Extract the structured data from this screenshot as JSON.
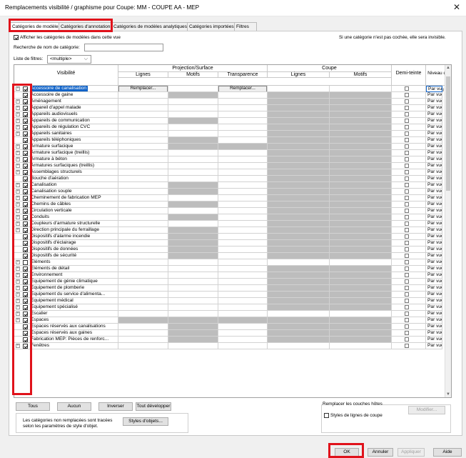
{
  "window": {
    "title": "Remplacements visibilité / graphisme pour Coupe: MM - COUPE AA - MEP",
    "close": "✕"
  },
  "tabs": [
    {
      "label": "Catégories de modèles",
      "active": true
    },
    {
      "label": "Catégories d'annotations"
    },
    {
      "label": "Catégories de modèles analytiques"
    },
    {
      "label": "Catégories importées"
    },
    {
      "label": "Filtres"
    }
  ],
  "show_categories_label": "Afficher les catégories de modèles dans cette vue",
  "hint": "Si une catégorie n'est pas cochée, elle sera invisible.",
  "search": {
    "label": "Recherche de nom de catégorie:",
    "value": ""
  },
  "filter_list": {
    "label": "Liste de filtres:",
    "value": "<multiple>"
  },
  "grid": {
    "headers": {
      "visibility": "Visibilité",
      "projection": "Projection/Surface",
      "section": "Coupe",
      "lines": "Lignes",
      "patterns": "Motifs",
      "transparency": "Transparence",
      "halftone": "Demi-teinte",
      "detail_level": "Niveau de détail"
    },
    "replace_label": "Remplacer...",
    "detail_value": "Par vue",
    "rows": [
      {
        "name": "Accessoire de canalisation",
        "checked": true,
        "sel": true,
        "exp": true,
        "g": [
          0,
          0,
          0,
          0,
          0
        ]
      },
      {
        "name": "Accessoire de gaine",
        "checked": true,
        "exp": false,
        "g": [
          0,
          1,
          0,
          1,
          1
        ]
      },
      {
        "name": "Aménagement",
        "checked": true,
        "exp": true,
        "g": [
          0,
          0,
          0,
          1,
          1
        ]
      },
      {
        "name": "Appareil d'appel malade",
        "checked": true,
        "exp": true,
        "g": [
          0,
          0,
          0,
          1,
          1
        ]
      },
      {
        "name": "Appareils audiovisuels",
        "checked": true,
        "exp": true,
        "g": [
          0,
          0,
          0,
          1,
          1
        ]
      },
      {
        "name": "Appareils de communication",
        "checked": true,
        "exp": true,
        "g": [
          0,
          1,
          0,
          1,
          1
        ]
      },
      {
        "name": "Appareils de régulation CVC",
        "checked": true,
        "exp": true,
        "g": [
          0,
          0,
          0,
          1,
          1
        ]
      },
      {
        "name": "Appareils sanitaires",
        "checked": true,
        "exp": true,
        "g": [
          0,
          0,
          0,
          1,
          1
        ]
      },
      {
        "name": "Appareils téléphoniques",
        "checked": true,
        "exp": false,
        "g": [
          0,
          1,
          0,
          1,
          1
        ]
      },
      {
        "name": "Armature surfacique",
        "checked": true,
        "exp": true,
        "g": [
          0,
          1,
          1,
          1,
          1
        ]
      },
      {
        "name": "Armature surfacique (treillis)",
        "checked": true,
        "exp": true,
        "g": [
          0,
          0,
          0,
          1,
          1
        ]
      },
      {
        "name": "Armature à béton",
        "checked": true,
        "exp": true,
        "g": [
          0,
          0,
          0,
          1,
          1
        ]
      },
      {
        "name": "Armatures surfaciques (treillis)",
        "checked": true,
        "exp": true,
        "g": [
          0,
          0,
          0,
          1,
          1
        ]
      },
      {
        "name": "Assemblages structurels",
        "checked": true,
        "exp": true,
        "g": [
          0,
          0,
          0,
          1,
          1
        ]
      },
      {
        "name": "Bouche d'aération",
        "checked": true,
        "exp": false,
        "g": [
          0,
          0,
          0,
          1,
          1
        ]
      },
      {
        "name": "Canalisation",
        "checked": true,
        "exp": true,
        "g": [
          0,
          1,
          0,
          1,
          1
        ]
      },
      {
        "name": "Canalisation souple",
        "checked": true,
        "exp": true,
        "g": [
          0,
          1,
          0,
          1,
          1
        ]
      },
      {
        "name": "Cheminement de fabrication MEP",
        "checked": true,
        "exp": true,
        "g": [
          0,
          0,
          0,
          1,
          1
        ]
      },
      {
        "name": "Chemins de câbles",
        "checked": true,
        "exp": true,
        "g": [
          0,
          1,
          0,
          1,
          1
        ]
      },
      {
        "name": "Circulation verticale",
        "checked": true,
        "exp": true,
        "g": [
          0,
          0,
          0,
          1,
          1
        ]
      },
      {
        "name": "Conduits",
        "checked": true,
        "exp": true,
        "g": [
          0,
          1,
          0,
          1,
          1
        ]
      },
      {
        "name": "Coupleurs d'armature structurelle",
        "checked": true,
        "exp": true,
        "g": [
          0,
          0,
          0,
          1,
          1
        ]
      },
      {
        "name": "Direction principale du ferraillage",
        "checked": true,
        "exp": true,
        "g": [
          0,
          1,
          0,
          1,
          1
        ]
      },
      {
        "name": "Dispositifs d'alarme incendie",
        "checked": true,
        "exp": false,
        "g": [
          0,
          1,
          0,
          1,
          1
        ]
      },
      {
        "name": "Dispositifs d'éclairage",
        "checked": true,
        "exp": false,
        "g": [
          0,
          1,
          0,
          1,
          1
        ]
      },
      {
        "name": "Dispositifs de données",
        "checked": true,
        "exp": false,
        "g": [
          0,
          1,
          0,
          1,
          1
        ]
      },
      {
        "name": "Dispositifs de sécurité",
        "checked": true,
        "exp": false,
        "g": [
          0,
          1,
          0,
          1,
          1
        ]
      },
      {
        "name": "Eléments",
        "checked": false,
        "exp": true,
        "g": [
          0,
          0,
          0,
          0,
          0
        ]
      },
      {
        "name": "Eléments de détail",
        "checked": true,
        "exp": true,
        "g": [
          0,
          0,
          0,
          1,
          1
        ]
      },
      {
        "name": "Environnement",
        "checked": true,
        "exp": true,
        "g": [
          0,
          0,
          0,
          1,
          1
        ]
      },
      {
        "name": "Equipement de génie climatique",
        "checked": true,
        "exp": true,
        "g": [
          0,
          0,
          0,
          1,
          1
        ]
      },
      {
        "name": "Equipement de plomberie",
        "checked": true,
        "exp": true,
        "g": [
          0,
          0,
          0,
          1,
          1
        ]
      },
      {
        "name": "Equipement du service d'alimenta...",
        "checked": true,
        "exp": true,
        "g": [
          0,
          0,
          0,
          1,
          1
        ]
      },
      {
        "name": "Equipement médical",
        "checked": true,
        "exp": true,
        "g": [
          0,
          0,
          0,
          1,
          1
        ]
      },
      {
        "name": "Equipement spécialisé",
        "checked": true,
        "exp": true,
        "g": [
          0,
          0,
          0,
          1,
          1
        ]
      },
      {
        "name": "Escalier",
        "checked": true,
        "exp": true,
        "g": [
          0,
          0,
          0,
          0,
          0
        ]
      },
      {
        "name": "Espaces",
        "checked": true,
        "exp": true,
        "g": [
          1,
          1,
          1,
          1,
          1
        ]
      },
      {
        "name": "Espaces réservés aux canalisations",
        "checked": true,
        "exp": false,
        "g": [
          0,
          1,
          0,
          1,
          1
        ]
      },
      {
        "name": "Espaces réservés aux gaines",
        "checked": true,
        "exp": false,
        "g": [
          0,
          1,
          0,
          1,
          1
        ]
      },
      {
        "name": "Fabrication MEP: Pièces de renforc...",
        "checked": true,
        "exp": false,
        "g": [
          0,
          1,
          0,
          1,
          1
        ]
      },
      {
        "name": "Fenêtres",
        "checked": true,
        "exp": true,
        "g": [
          0,
          0,
          0,
          0,
          0
        ]
      }
    ]
  },
  "buttons": {
    "all": "Tous",
    "none": "Aucun",
    "invert": "Inverser",
    "expand_all": "Tout développer",
    "object_styles": "Styles d'objets...",
    "modify": "Modifier...",
    "ok": "OK",
    "cancel": "Annuler",
    "apply": "Appliquer",
    "help": "Aide"
  },
  "note_line1": "Les catégories non remplacées sont tracées",
  "note_line2": "selon les paramètres de style d'objet.",
  "host_layers": {
    "title": "Remplacer les couches hôtes",
    "cut_line_styles": "Styles de lignes de coupe"
  },
  "colors": {
    "selection": "#1264c8",
    "highlight": "#e0121b",
    "gray_cell": "#bdbdbd"
  }
}
